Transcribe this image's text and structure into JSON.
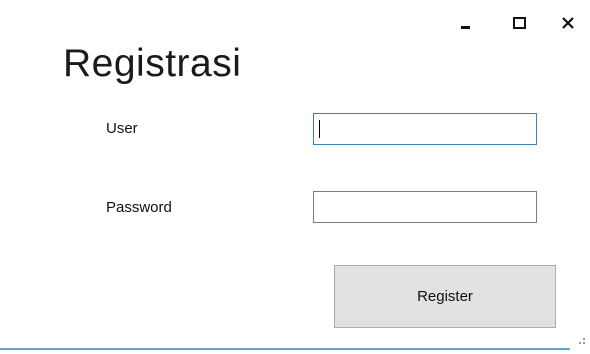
{
  "window": {
    "title": "Registrasi",
    "controls": {
      "minimize": "minimize-icon",
      "maximize": "maximize-icon",
      "close": "close-icon"
    }
  },
  "form": {
    "user_label": "User",
    "user_value": "",
    "password_label": "Password",
    "password_value": "",
    "register_label": "Register"
  },
  "colors": {
    "focus_border": "#3c7fb1",
    "button_bg": "#e1e1e1",
    "accent_line": "#5aa9d6"
  }
}
